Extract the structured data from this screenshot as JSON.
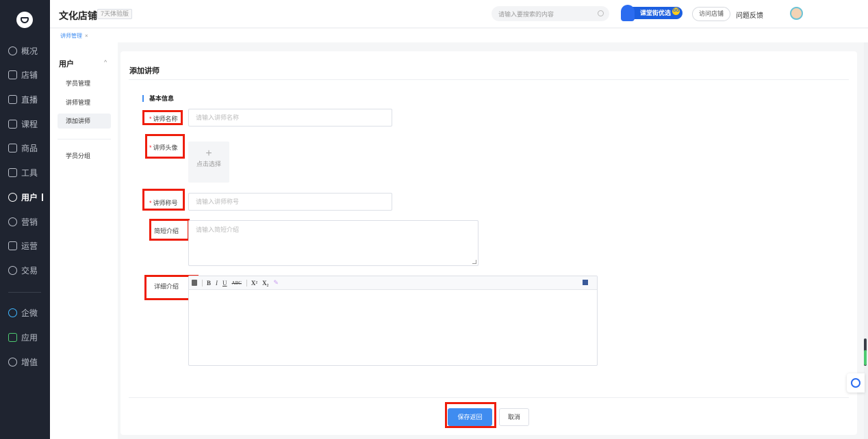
{
  "header": {
    "shop_name": "文化店铺",
    "trial_badge": "7天体验版",
    "search_placeholder": "请输入要搜索的内容",
    "promo_label": "课堂街优选",
    "promo_go": "GO",
    "visit_shop": "访问店铺",
    "feedback": "问题反馈"
  },
  "nav": {
    "items": [
      {
        "label": "概况",
        "icon": "dashboard-icon"
      },
      {
        "label": "店铺",
        "icon": "shop-icon"
      },
      {
        "label": "直播",
        "icon": "live-icon"
      },
      {
        "label": "课程",
        "icon": "course-icon"
      },
      {
        "label": "商品",
        "icon": "goods-icon"
      },
      {
        "label": "工具",
        "icon": "toolbox-icon"
      },
      {
        "label": "用户",
        "icon": "user-icon"
      },
      {
        "label": "营销",
        "icon": "marketing-icon"
      },
      {
        "label": "运营",
        "icon": "operation-icon"
      },
      {
        "label": "交易",
        "icon": "trade-icon"
      },
      {
        "label": "企微",
        "icon": "wecom-icon"
      },
      {
        "label": "应用",
        "icon": "apps-icon"
      },
      {
        "label": "增值",
        "icon": "value-added-icon"
      }
    ],
    "active": "用户"
  },
  "breadcrumb_tab": {
    "label": "讲师管理",
    "close": "×"
  },
  "subnav": {
    "title": "用户",
    "caret": "^",
    "items": [
      "学员管理",
      "讲师管理",
      "添加讲师",
      "学员分组"
    ],
    "active": "添加讲师"
  },
  "form": {
    "title": "添加讲师",
    "section": "基本信息",
    "fields": {
      "name_label": "讲师名称",
      "name_placeholder": "请输入讲师名称",
      "avatar_label": "讲师头像",
      "avatar_upload": "点击选择",
      "avatar_plus": "+",
      "title_label": "讲师称号",
      "title_placeholder": "请输入讲师称号",
      "brief_label": "简短介绍",
      "brief_placeholder": "请输入简短介绍",
      "detail_label": "详细介绍"
    },
    "required_mark": "*",
    "toolbar": [
      "B",
      "I",
      "U",
      "ABC",
      "X²",
      "X₂"
    ],
    "save_button": "保存返回",
    "cancel_button": "取消"
  },
  "colors": {
    "sidebar_bg": "#1f2430",
    "accent": "#3f8cf0",
    "highlight_box": "#ee1d0b",
    "required": "#f5222d"
  }
}
